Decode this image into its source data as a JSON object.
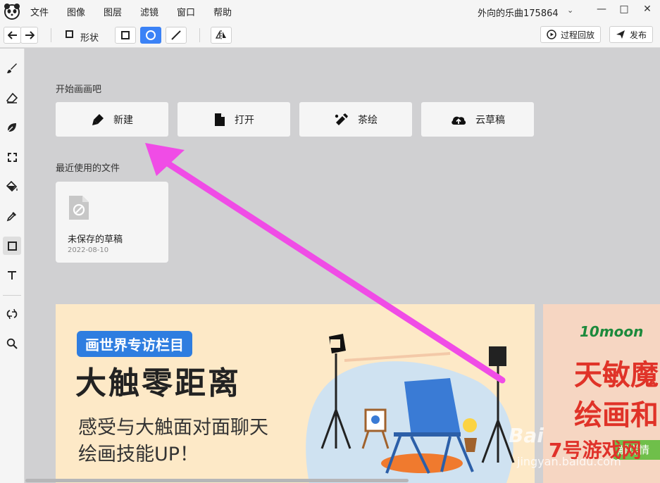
{
  "menu": {
    "items": [
      "文件",
      "图像",
      "图层",
      "滤镜",
      "窗口",
      "帮助"
    ]
  },
  "user": {
    "name": "外向的乐曲175864"
  },
  "toolbar": {
    "shape_label": "形状",
    "replay_label": "过程回放",
    "publish_label": "发布"
  },
  "start": {
    "title": "开始画画吧",
    "actions": [
      {
        "label": "新建",
        "icon": "pen-icon"
      },
      {
        "label": "打开",
        "icon": "file-icon"
      },
      {
        "label": "茶绘",
        "icon": "tea-drawing-icon"
      },
      {
        "label": "云草稿",
        "icon": "cloud-upload-icon"
      }
    ]
  },
  "recent": {
    "title": "最近使用的文件",
    "files": [
      {
        "name": "未保存的草稿",
        "date": "2022-08-10"
      }
    ]
  },
  "banner": {
    "tag": "画世界专访栏目",
    "headline": "大触零距离",
    "line1": "感受与大触面对面聊天",
    "line2": "绘画技能UP！"
  },
  "banner2": {
    "brand": "10moon",
    "line1": "天敏魔",
    "line2": "绘画和",
    "button": "解详情"
  },
  "watermark": {
    "baidu": "Bai",
    "jingyan": "jingyan.baidu.com",
    "site": "7号游戏网"
  },
  "colors": {
    "accent": "#3b82f6",
    "arrow": "#f04ce6",
    "banner_bg": "#fde9c7",
    "tag_bg": "#2e7de0"
  }
}
